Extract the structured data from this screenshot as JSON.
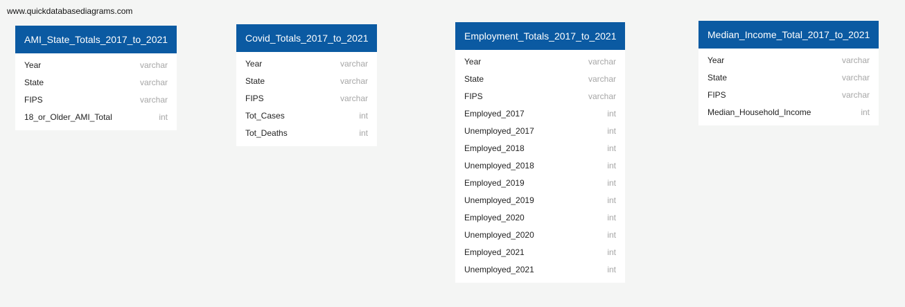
{
  "watermark": "www.quickdatabasediagrams.com",
  "tables": [
    {
      "name": "AMI_State_Totals_2017_to_2021",
      "fields": [
        {
          "name": "Year",
          "type": "varchar"
        },
        {
          "name": "State",
          "type": "varchar"
        },
        {
          "name": "FIPS",
          "type": "varchar"
        },
        {
          "name": "18_or_Older_AMI_Total",
          "type": "int"
        }
      ]
    },
    {
      "name": "Covid_Totals_2017_to_2021",
      "fields": [
        {
          "name": "Year",
          "type": "varchar"
        },
        {
          "name": "State",
          "type": "varchar"
        },
        {
          "name": "FIPS",
          "type": "varchar"
        },
        {
          "name": "Tot_Cases",
          "type": "int"
        },
        {
          "name": "Tot_Deaths",
          "type": "int"
        }
      ]
    },
    {
      "name": "Employment_Totals_2017_to_2021",
      "fields": [
        {
          "name": "Year",
          "type": "varchar"
        },
        {
          "name": "State",
          "type": "varchar"
        },
        {
          "name": "FIPS",
          "type": "varchar"
        },
        {
          "name": "Employed_2017",
          "type": "int"
        },
        {
          "name": "Unemployed_2017",
          "type": "int"
        },
        {
          "name": "Employed_2018",
          "type": "int"
        },
        {
          "name": "Unemployed_2018",
          "type": "int"
        },
        {
          "name": "Employed_2019",
          "type": "int"
        },
        {
          "name": "Unemployed_2019",
          "type": "int"
        },
        {
          "name": "Employed_2020",
          "type": "int"
        },
        {
          "name": "Unemployed_2020",
          "type": "int"
        },
        {
          "name": "Employed_2021",
          "type": "int"
        },
        {
          "name": "Unemployed_2021",
          "type": "int"
        }
      ]
    },
    {
      "name": "Median_Income_Total_2017_to_2021",
      "fields": [
        {
          "name": "Year",
          "type": "varchar"
        },
        {
          "name": "State",
          "type": "varchar"
        },
        {
          "name": "FIPS",
          "type": "varchar"
        },
        {
          "name": "Median_Household_Income",
          "type": "int"
        }
      ]
    }
  ]
}
